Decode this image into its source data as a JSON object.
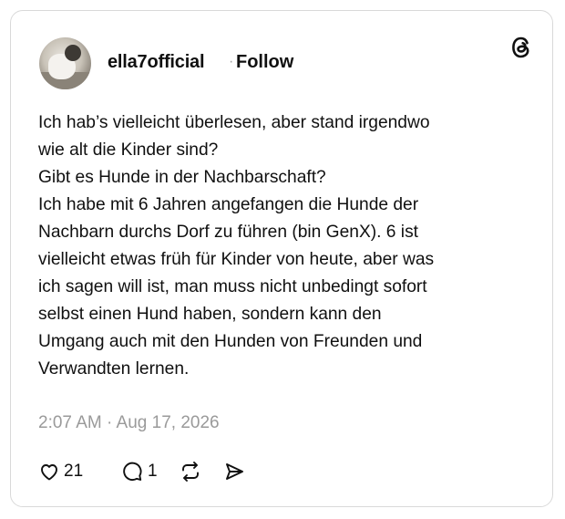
{
  "post": {
    "author": "ella7official",
    "separator": "·",
    "follow_label": "Follow",
    "lines": [
      "Ich hab’s vielleicht überlesen, aber stand irgendwo",
      "wie alt die Kinder sind?",
      "Gibt es Hunde in der Nachbarschaft?",
      "Ich habe mit 6 Jahren angefangen die Hunde der",
      "Nachbarn durchs Dorf zu führen (bin GenX). 6 ist",
      "vielleicht etwas früh für Kinder von heute, aber was",
      "ich sagen will ist, man muss nicht unbedingt sofort",
      "selbst einen Hund haben, sondern kann den",
      "Umgang auch mit den Hunden von Freunden und",
      "Verwandten lernen."
    ],
    "timestamp": "2:07 AM · Aug 17, 2026"
  },
  "actions": {
    "like_count": "21",
    "reply_count": "1"
  },
  "icons": {
    "logo": "threads-logo-icon",
    "like": "heart-icon",
    "reply": "comment-icon",
    "repost": "repost-icon",
    "share": "send-icon"
  },
  "colors": {
    "text": "#101010",
    "muted": "#9a9a9a",
    "border": "#d9d9d9"
  }
}
